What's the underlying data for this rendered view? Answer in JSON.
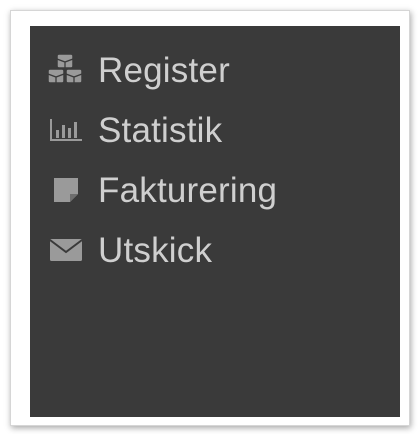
{
  "sidebar": {
    "items": [
      {
        "label": "Register",
        "icon": "cubes-icon"
      },
      {
        "label": "Statistik",
        "icon": "bar-chart-icon"
      },
      {
        "label": "Fakturering",
        "icon": "sticky-note-icon"
      },
      {
        "label": "Utskick",
        "icon": "envelope-icon"
      }
    ]
  },
  "colors": {
    "sidebar_bg": "#3a3a3a",
    "text": "#cfcfcf",
    "icon": "#9a9a9a"
  }
}
